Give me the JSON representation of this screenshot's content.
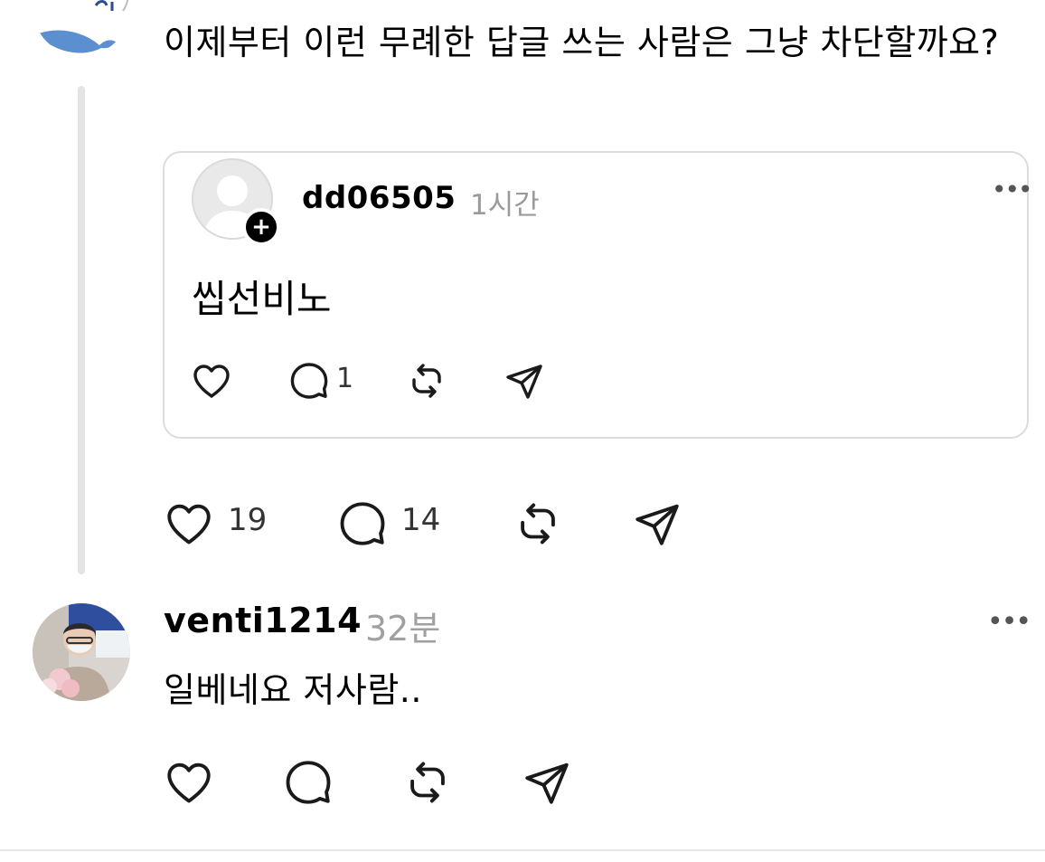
{
  "post": {
    "text": "이제부터 이런 무례한 답글 쓰는 사람은 그냥 차단할까요?",
    "likes": "19",
    "comments": "14"
  },
  "quoted": {
    "username": "dd06505",
    "time": "1시간",
    "text": "씹선비노",
    "comments": "1",
    "more": "•••"
  },
  "reply": {
    "username": "venti1214",
    "time": "32분",
    "text": "일베네요 저사람..",
    "more": "•••"
  },
  "icons": {
    "like": "heart-icon",
    "comment": "speech-bubble-icon",
    "repost": "repost-icon",
    "share": "send-icon",
    "follow": "plus-icon",
    "more": "more-icon"
  },
  "colors": {
    "text": "#000000",
    "muted": "#9a9a9a",
    "border": "#dcdcdc",
    "thread_line": "#e4e4e4"
  }
}
